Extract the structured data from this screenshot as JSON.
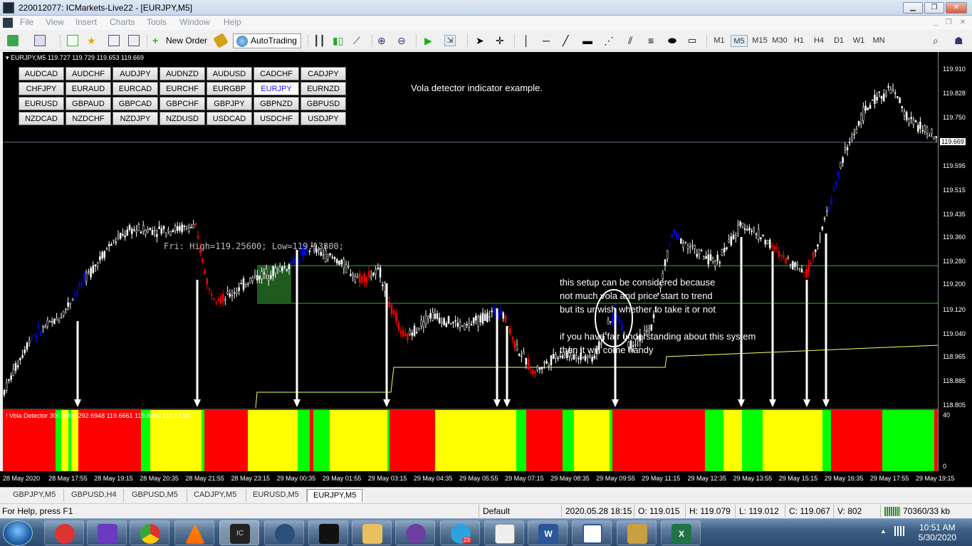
{
  "window": {
    "title": "220012077: ICMarkets-Live22 - [EURJPY,M5]"
  },
  "menu": [
    "File",
    "View",
    "Insert",
    "Charts",
    "Tools",
    "Window",
    "Help"
  ],
  "toolbar": {
    "new_order": "New Order",
    "autotrading": "AutoTrading",
    "timeframes": [
      "M1",
      "M5",
      "M15",
      "M30",
      "H1",
      "H4",
      "D1",
      "W1",
      "MN"
    ],
    "active_timeframe": "M5"
  },
  "chart": {
    "header": "EURJPY,M5  119.727 119.729 119.653 119.669",
    "pairs": [
      "AUDCAD",
      "AUDCHF",
      "AUDJPY",
      "AUDNZD",
      "AUDUSD",
      "CADCHF",
      "CADJPY",
      "CHFJPY",
      "EURAUD",
      "EURCAD",
      "EURCHF",
      "EURGBP",
      "EURJPY",
      "EURNZD",
      "EURUSD",
      "GBPAUD",
      "GBPCAD",
      "GBPCHF",
      "GBPJPY",
      "GBPNZD",
      "GBPUSD",
      "NZDCAD",
      "NZDCHF",
      "NZDJPY",
      "NZDUSD",
      "USDCAD",
      "USDCHF",
      "USDJPY"
    ],
    "selected_pair": "EURJPY",
    "heading": "Vola detector indicator example.",
    "hilo": "Fri:  High=119.25600;  Low=119.13800;",
    "note_lines": [
      "this setup can be considered because",
      "not much vola and price start to trend",
      "but its ur wish whether to take it or not",
      "",
      "if you have fair understanding about this system",
      "then it will come handy"
    ],
    "price_labels": [
      "119.910",
      "119.828",
      "119.750",
      "119.669",
      "119.595",
      "119.515",
      "119.435",
      "119.360",
      "119.280",
      "119.200",
      "119.120",
      "119.040",
      "118.965",
      "118.885",
      "118.805"
    ],
    "current_price": "119.669",
    "indicator_label": "! Vola Detector 300.0000 292.6948 119.6661 119.8894 119.5138",
    "indicator_scale": [
      "40",
      "0"
    ],
    "time_labels": [
      "28 May 2020",
      "28 May 17:55",
      "28 May 19:15",
      "28 May 20:35",
      "28 May 21:55",
      "28 May 23:15",
      "29 May 00:35",
      "29 May 01:55",
      "29 May 03:15",
      "29 May 04:35",
      "29 May 05:55",
      "29 May 07:15",
      "29 May 08:35",
      "29 May 09:55",
      "29 May 11:15",
      "29 May 12:35",
      "29 May 13:55",
      "29 May 15:15",
      "29 May 16:35",
      "29 May 17:55",
      "29 May 19:15"
    ],
    "colors": {
      "bull": "#0000ff",
      "bear": "#ff0000",
      "candle": "#ffffff",
      "level": "#22aa22",
      "red_zone": "#ff0000",
      "yellow_zone": "#ffff00",
      "green_zone": "#00ff00"
    }
  },
  "tabs": [
    "GBPJPY,M5",
    "GBPUSD,H4",
    "GBPUSD,M5",
    "CADJPY,M5",
    "EURUSD,M5",
    "EURJPY,M5"
  ],
  "active_tab": "EURJPY,M5",
  "status": {
    "help": "For Help, press F1",
    "profile": "Default",
    "datetime": "2020.05.28 18:15",
    "open": "O: 119.015",
    "high": "H: 119.079",
    "low": "L: 119.012",
    "close": "C: 119.067",
    "volume": "V: 802",
    "traffic": "70360/33 kb"
  },
  "taskbar": {
    "time": "10:51 AM",
    "date": "5/30/2020",
    "badge": "23"
  }
}
